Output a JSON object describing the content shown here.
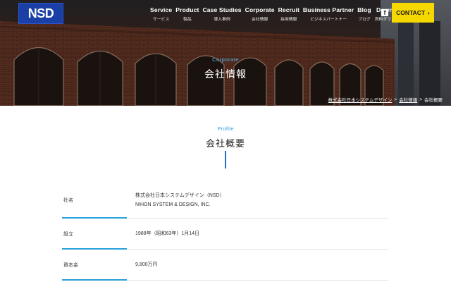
{
  "brand": {
    "logo_text": "NSD",
    "accent": "#2aa0dc",
    "contact_color": "#f5d800",
    "logo_color": "#1a3fa6"
  },
  "nav": [
    {
      "en": "Service",
      "ja": "サービス"
    },
    {
      "en": "Product",
      "ja": "製品"
    },
    {
      "en": "Case Studies",
      "ja": "導入事例"
    },
    {
      "en": "Corporate",
      "ja": "会社情報"
    },
    {
      "en": "Recruit",
      "ja": "採用情報"
    },
    {
      "en": "Business Partner",
      "ja": "ビジネスパートナー"
    },
    {
      "en": "Blog",
      "ja": "ブログ"
    },
    {
      "en": "Download",
      "ja": "資料ダウンロード"
    }
  ],
  "social": {
    "facebook_icon": "facebook-icon",
    "facebook_glyph": "f"
  },
  "contact": {
    "label": "CONTACT",
    "arrow": "›"
  },
  "hero": {
    "subtitle": "Corporate",
    "title": "会社情報"
  },
  "breadcrumb": {
    "items": [
      "株式会社日本システムデザイン",
      "会社情報",
      "会社概要"
    ],
    "separator": ">"
  },
  "section": {
    "subtitle": "Profile",
    "title": "会社概要"
  },
  "profile": {
    "rows": [
      {
        "label": "社名",
        "value_lines": [
          "株式会社日本システムデザイン（NSD）",
          "NIHON SYSTEM & DESIGN, INC."
        ]
      },
      {
        "label": "設立",
        "value_lines": [
          "1988年（昭和63年）1月14日"
        ]
      },
      {
        "label": "資本金",
        "value_lines": [
          "9,800万円"
        ]
      }
    ]
  }
}
